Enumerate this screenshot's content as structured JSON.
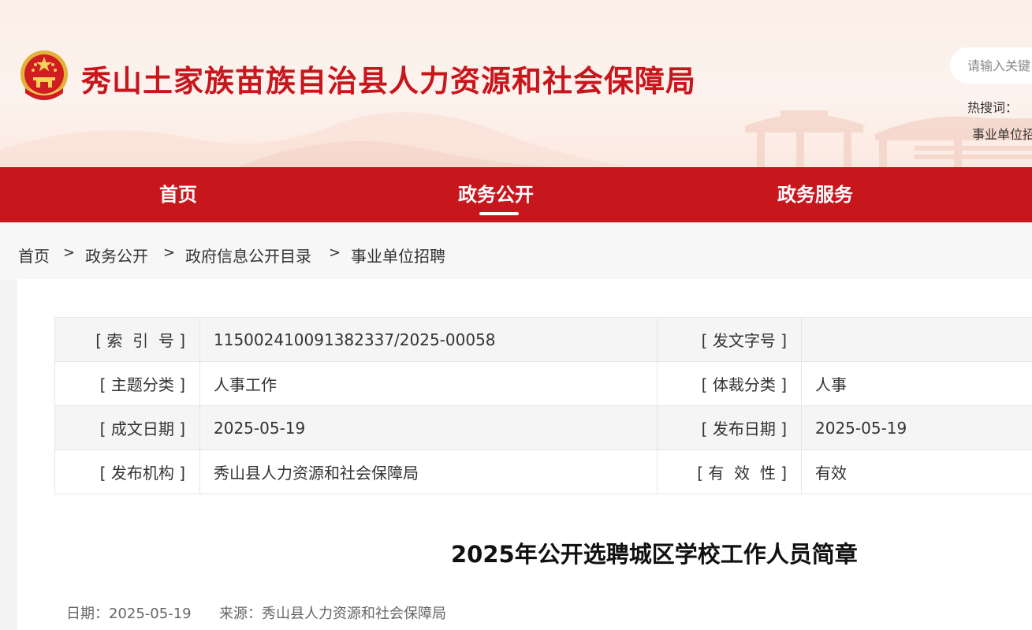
{
  "header": {
    "site_title": "秀山土家族苗族自治县人力资源和社会保障局",
    "search_placeholder": "请输入关键",
    "hot_label": "热搜词：",
    "hot_item": "事业单位招"
  },
  "nav": {
    "items": [
      {
        "label": "首页"
      },
      {
        "label": "政务公开"
      },
      {
        "label": "政务服务"
      }
    ],
    "active_index": 1
  },
  "breadcrumb": {
    "items": [
      "首页",
      "政务公开",
      "政府信息公开目录",
      "事业单位招聘"
    ],
    "separator": ">"
  },
  "meta_table": {
    "rows": [
      {
        "label1": "[ 索  引  号 ]",
        "value1": "115002410091382337/2025-00058",
        "label2": "[ 发文字号 ]",
        "value2": ""
      },
      {
        "label1": "[ 主题分类 ]",
        "value1": "人事工作",
        "label2": "[ 体裁分类 ]",
        "value2": "人事"
      },
      {
        "label1": "[ 成文日期 ]",
        "value1": "2025-05-19",
        "label2": "[ 发布日期 ]",
        "value2": "2025-05-19"
      },
      {
        "label1": "[ 发布机构 ]",
        "value1": "秀山县人力资源和社会保障局",
        "label2": "[ 有  效  性 ]",
        "value2": "有效"
      }
    ]
  },
  "article": {
    "title": "2025年公开选聘城区学校工作人员简章",
    "date_label": "日期：2025-05-19",
    "source_label": "来源：秀山县人力资源和社会保障局"
  },
  "colors": {
    "brand_red": "#c8161d",
    "header_bg": "#fbeee6"
  }
}
